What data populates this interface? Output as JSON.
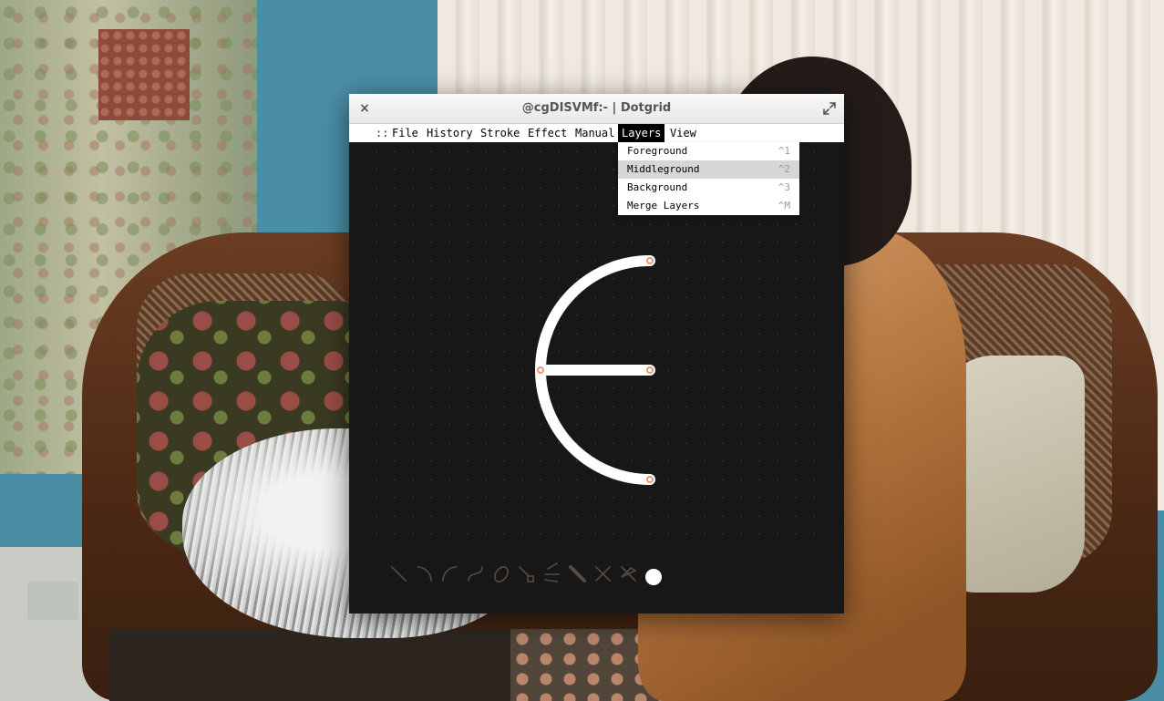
{
  "window": {
    "title": "@cgDISVMf:- | Dotgrid",
    "close_glyph": "×"
  },
  "menu": {
    "grip": "::",
    "items": [
      {
        "label": "File"
      },
      {
        "label": "History"
      },
      {
        "label": "Stroke"
      },
      {
        "label": "Effect"
      },
      {
        "label": "Manual"
      },
      {
        "label": "Layers",
        "active": true
      },
      {
        "label": "View"
      }
    ]
  },
  "layers_menu": {
    "items": [
      {
        "label": "Foreground",
        "shortcut": "^1"
      },
      {
        "label": "Middleground",
        "shortcut": "^2",
        "highlighted": true
      },
      {
        "label": "Background",
        "shortcut": "^3"
      },
      {
        "label": "Merge Layers",
        "shortcut": "^M"
      }
    ]
  },
  "toolbar": {
    "tools": [
      {
        "icon": "line-icon"
      },
      {
        "icon": "arc-clockwise-icon"
      },
      {
        "icon": "arc-counterclockwise-icon"
      },
      {
        "icon": "bezier-icon"
      },
      {
        "icon": "close-path-icon"
      },
      {
        "icon": "linecap-icon"
      },
      {
        "icon": "linejoin-icon"
      },
      {
        "icon": "thickness-icon"
      },
      {
        "icon": "mirror-icon"
      },
      {
        "icon": "fill-icon"
      },
      {
        "icon": "color-icon"
      }
    ]
  },
  "colors": {
    "background": "#171717",
    "stroke": "#ffffff",
    "grid_dot": "#3b3b3b",
    "vertex": "#e09b74",
    "tool_icon": "#5a4a3e"
  }
}
